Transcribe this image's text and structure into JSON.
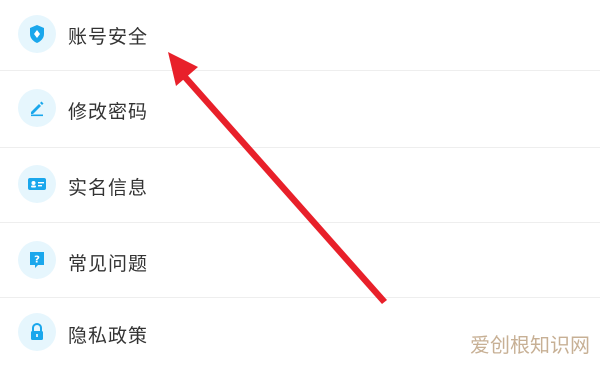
{
  "menu": {
    "items": [
      {
        "label": "账号安全",
        "icon": "shield-icon"
      },
      {
        "label": "修改密码",
        "icon": "pencil-icon"
      },
      {
        "label": "实名信息",
        "icon": "id-card-icon"
      },
      {
        "label": "常见问题",
        "icon": "question-icon"
      },
      {
        "label": "隐私政策",
        "icon": "lock-icon"
      }
    ]
  },
  "watermark": {
    "text": "爱创根知识网"
  },
  "colors": {
    "icon_blue": "#1aa7ec",
    "icon_bg": "#e6f6fd",
    "arrow_red": "#e8202a",
    "divider": "#eeeeee"
  }
}
